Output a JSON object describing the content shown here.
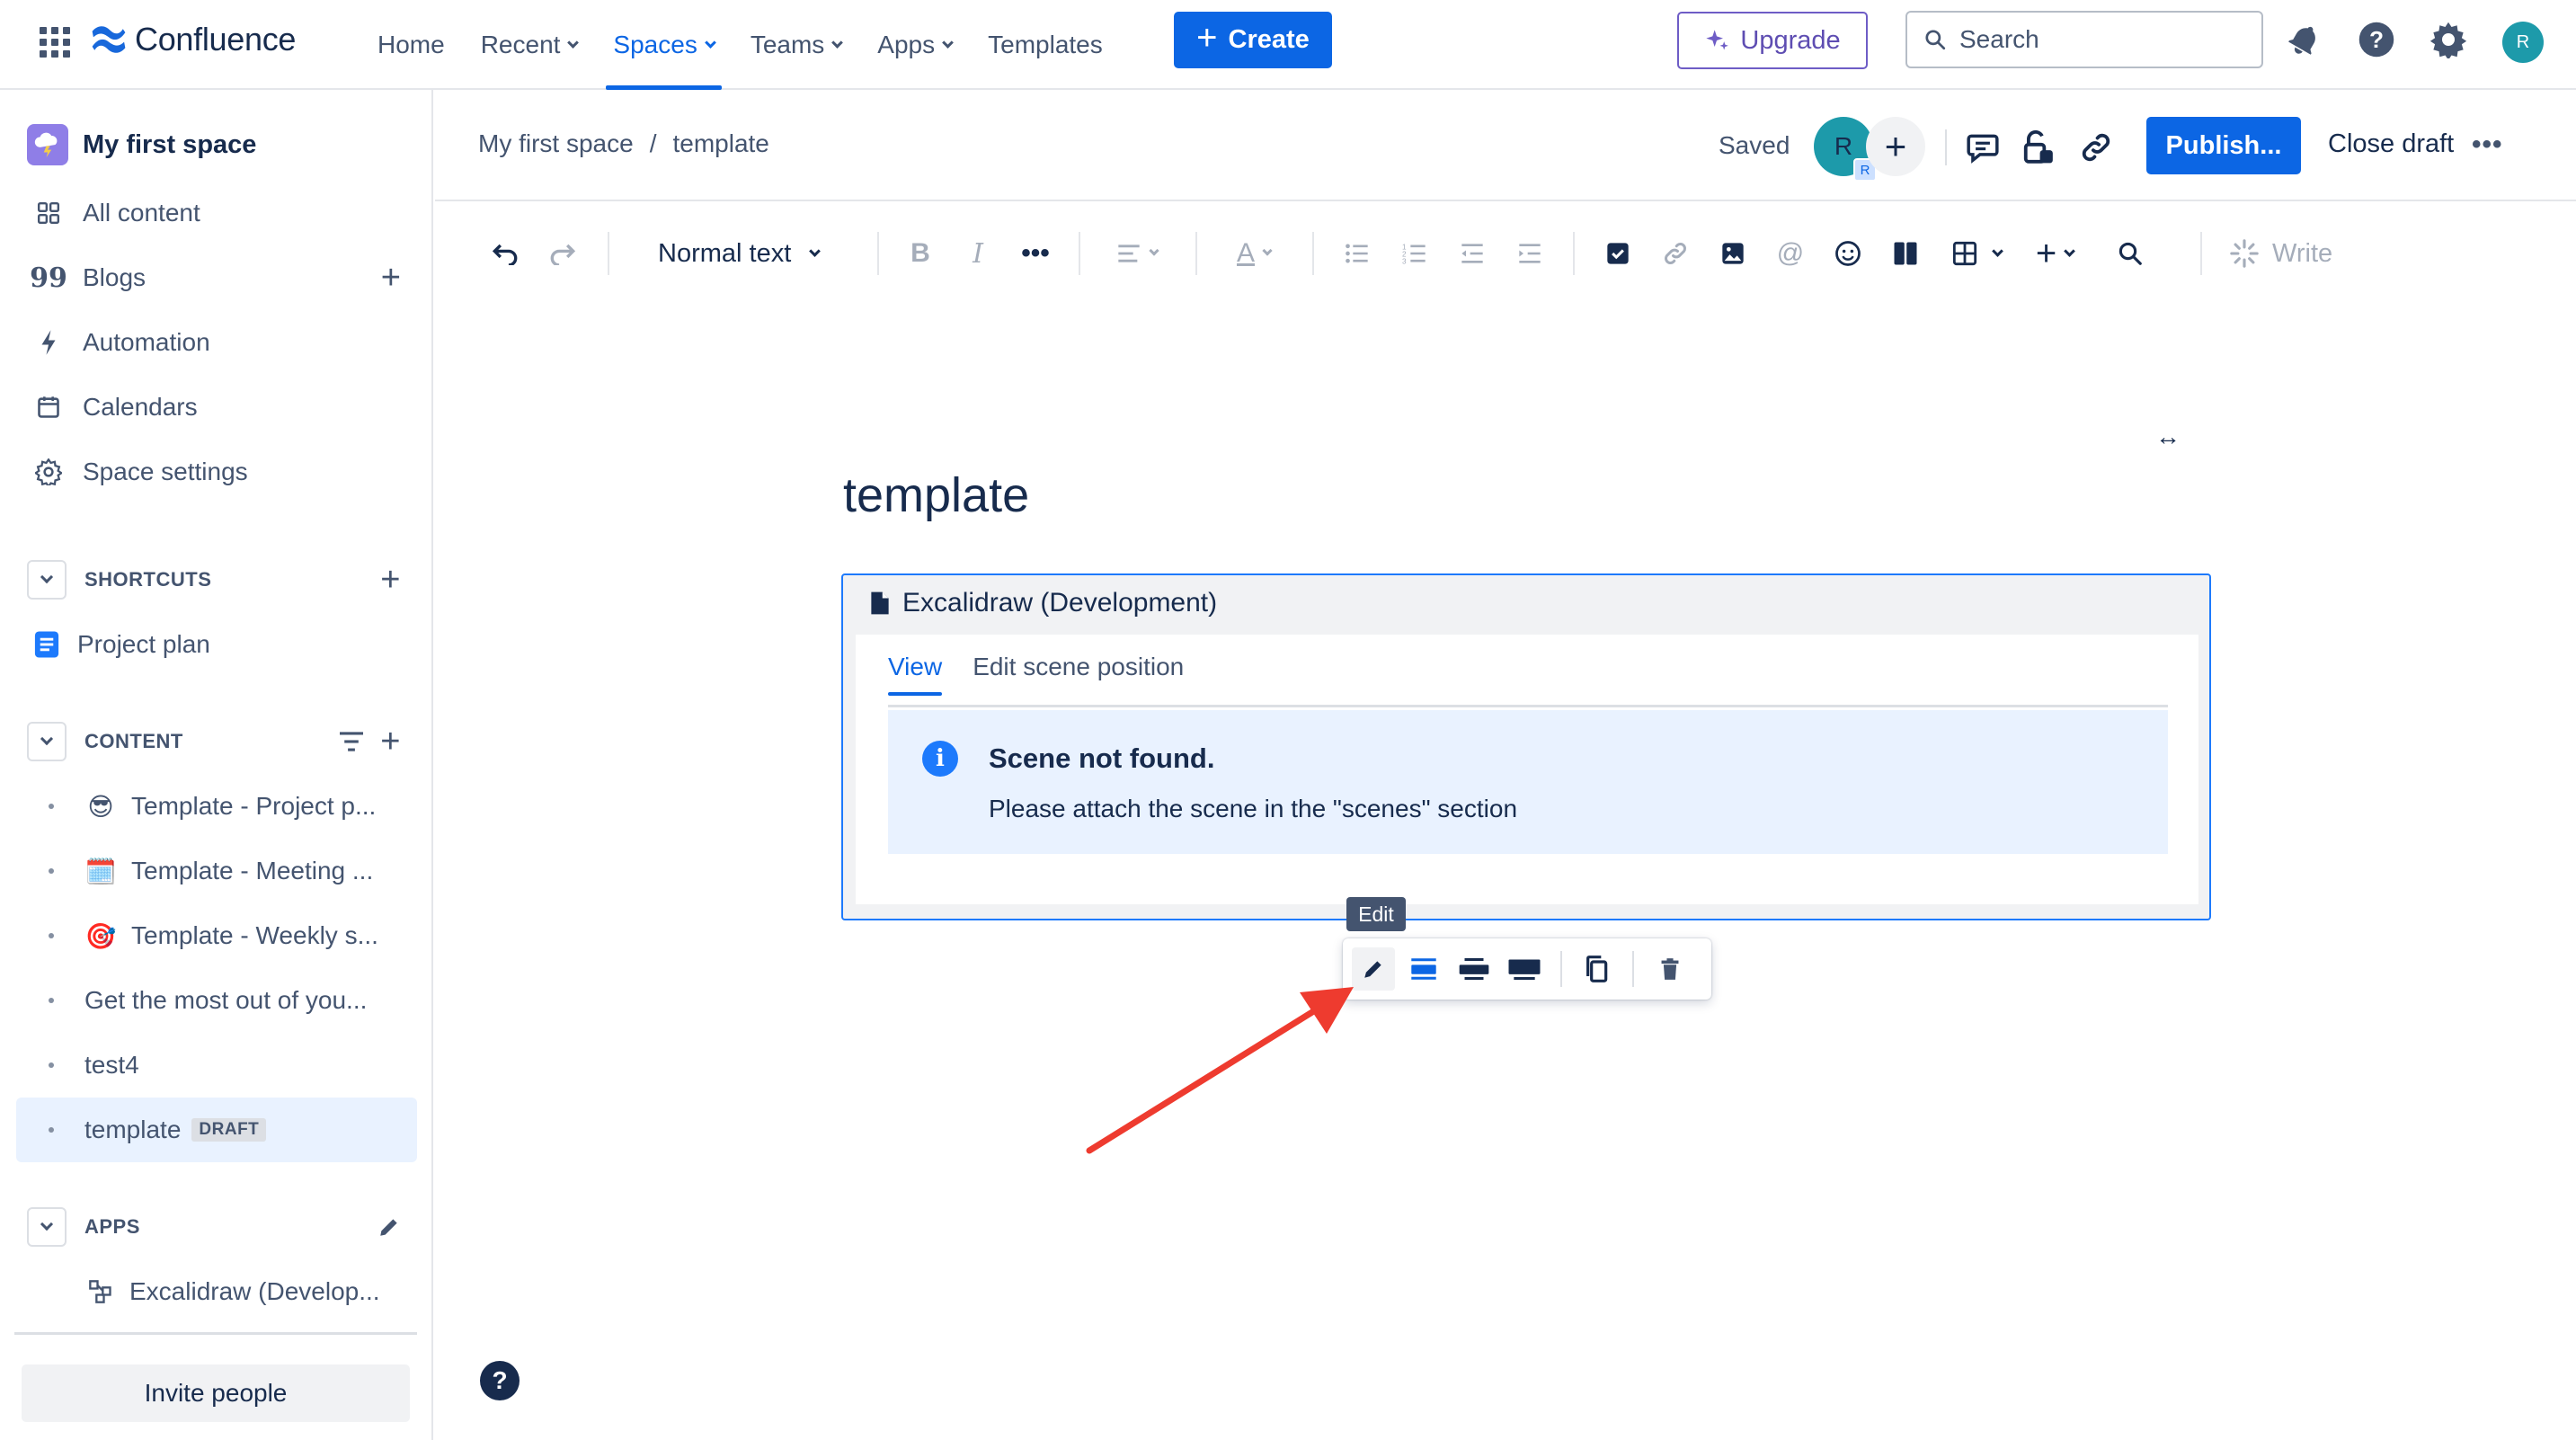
{
  "topnav": {
    "product": "Confluence",
    "links": [
      {
        "label": "Home",
        "dropdown": false
      },
      {
        "label": "Recent",
        "dropdown": true
      },
      {
        "label": "Spaces",
        "dropdown": true,
        "active": true
      },
      {
        "label": "Teams",
        "dropdown": true
      },
      {
        "label": "Apps",
        "dropdown": true
      },
      {
        "label": "Templates",
        "dropdown": false
      }
    ],
    "create_label": "Create",
    "upgrade_label": "Upgrade",
    "search_placeholder": "Search",
    "avatar_initial": "R",
    "icons": [
      "app-switcher-icon",
      "notifications-icon",
      "help-icon",
      "settings-icon"
    ]
  },
  "sidebar": {
    "space_name": "My first space",
    "items": [
      {
        "label": "All content",
        "icon": "all-content-icon"
      },
      {
        "label": "Blogs",
        "icon": "quote-icon"
      },
      {
        "label": "Automation",
        "icon": "lightning-icon"
      },
      {
        "label": "Calendars",
        "icon": "calendar-icon"
      },
      {
        "label": "Space settings",
        "icon": "gear-icon"
      }
    ],
    "shortcuts_label": "SHORTCUTS",
    "shortcuts": [
      {
        "label": "Project plan",
        "icon": "document-icon"
      }
    ],
    "content_label": "CONTENT",
    "content": [
      {
        "label": "Template - Project p...",
        "emoji": "😎"
      },
      {
        "label": "Template - Meeting ...",
        "emoji": "🗓️"
      },
      {
        "label": "Template - Weekly s...",
        "emoji": "🎯"
      },
      {
        "label": "Get the most out of you...",
        "emoji": ""
      },
      {
        "label": "test4",
        "emoji": ""
      },
      {
        "label": "template",
        "emoji": "",
        "tag": "DRAFT",
        "selected": true
      }
    ],
    "apps_label": "APPS",
    "apps": [
      {
        "label": "Excalidraw (Develop...",
        "icon": "excalidraw-icon"
      }
    ],
    "invite_label": "Invite people"
  },
  "editor_header": {
    "breadcrumb": [
      "My first space",
      "template"
    ],
    "breadcrumb_separator": "/",
    "status": "Saved",
    "avatar_initial": "R",
    "avatar_badge": "R",
    "publish_label": "Publish...",
    "close_draft_label": "Close draft",
    "more_label": "•••"
  },
  "toolbar": {
    "text_style": "Normal text",
    "write_label": "Write",
    "more_label": "•••"
  },
  "page": {
    "title": "template",
    "width_toggle": "↔"
  },
  "macro": {
    "title": "Excalidraw (Development)",
    "tabs": [
      "View",
      "Edit scene position"
    ],
    "active_tab": "View",
    "notice_title": "Scene not found.",
    "notice_text": "Please attach the scene in the \"scenes\" section"
  },
  "floating_toolbar": {
    "tooltip": "Edit"
  },
  "help_fab": "?",
  "colors": {
    "brand": "#0c66e4",
    "upgrade": "#5e4db2",
    "selection_bg": "#e9f2ff",
    "annotation_arrow": "#ee3b2f"
  }
}
